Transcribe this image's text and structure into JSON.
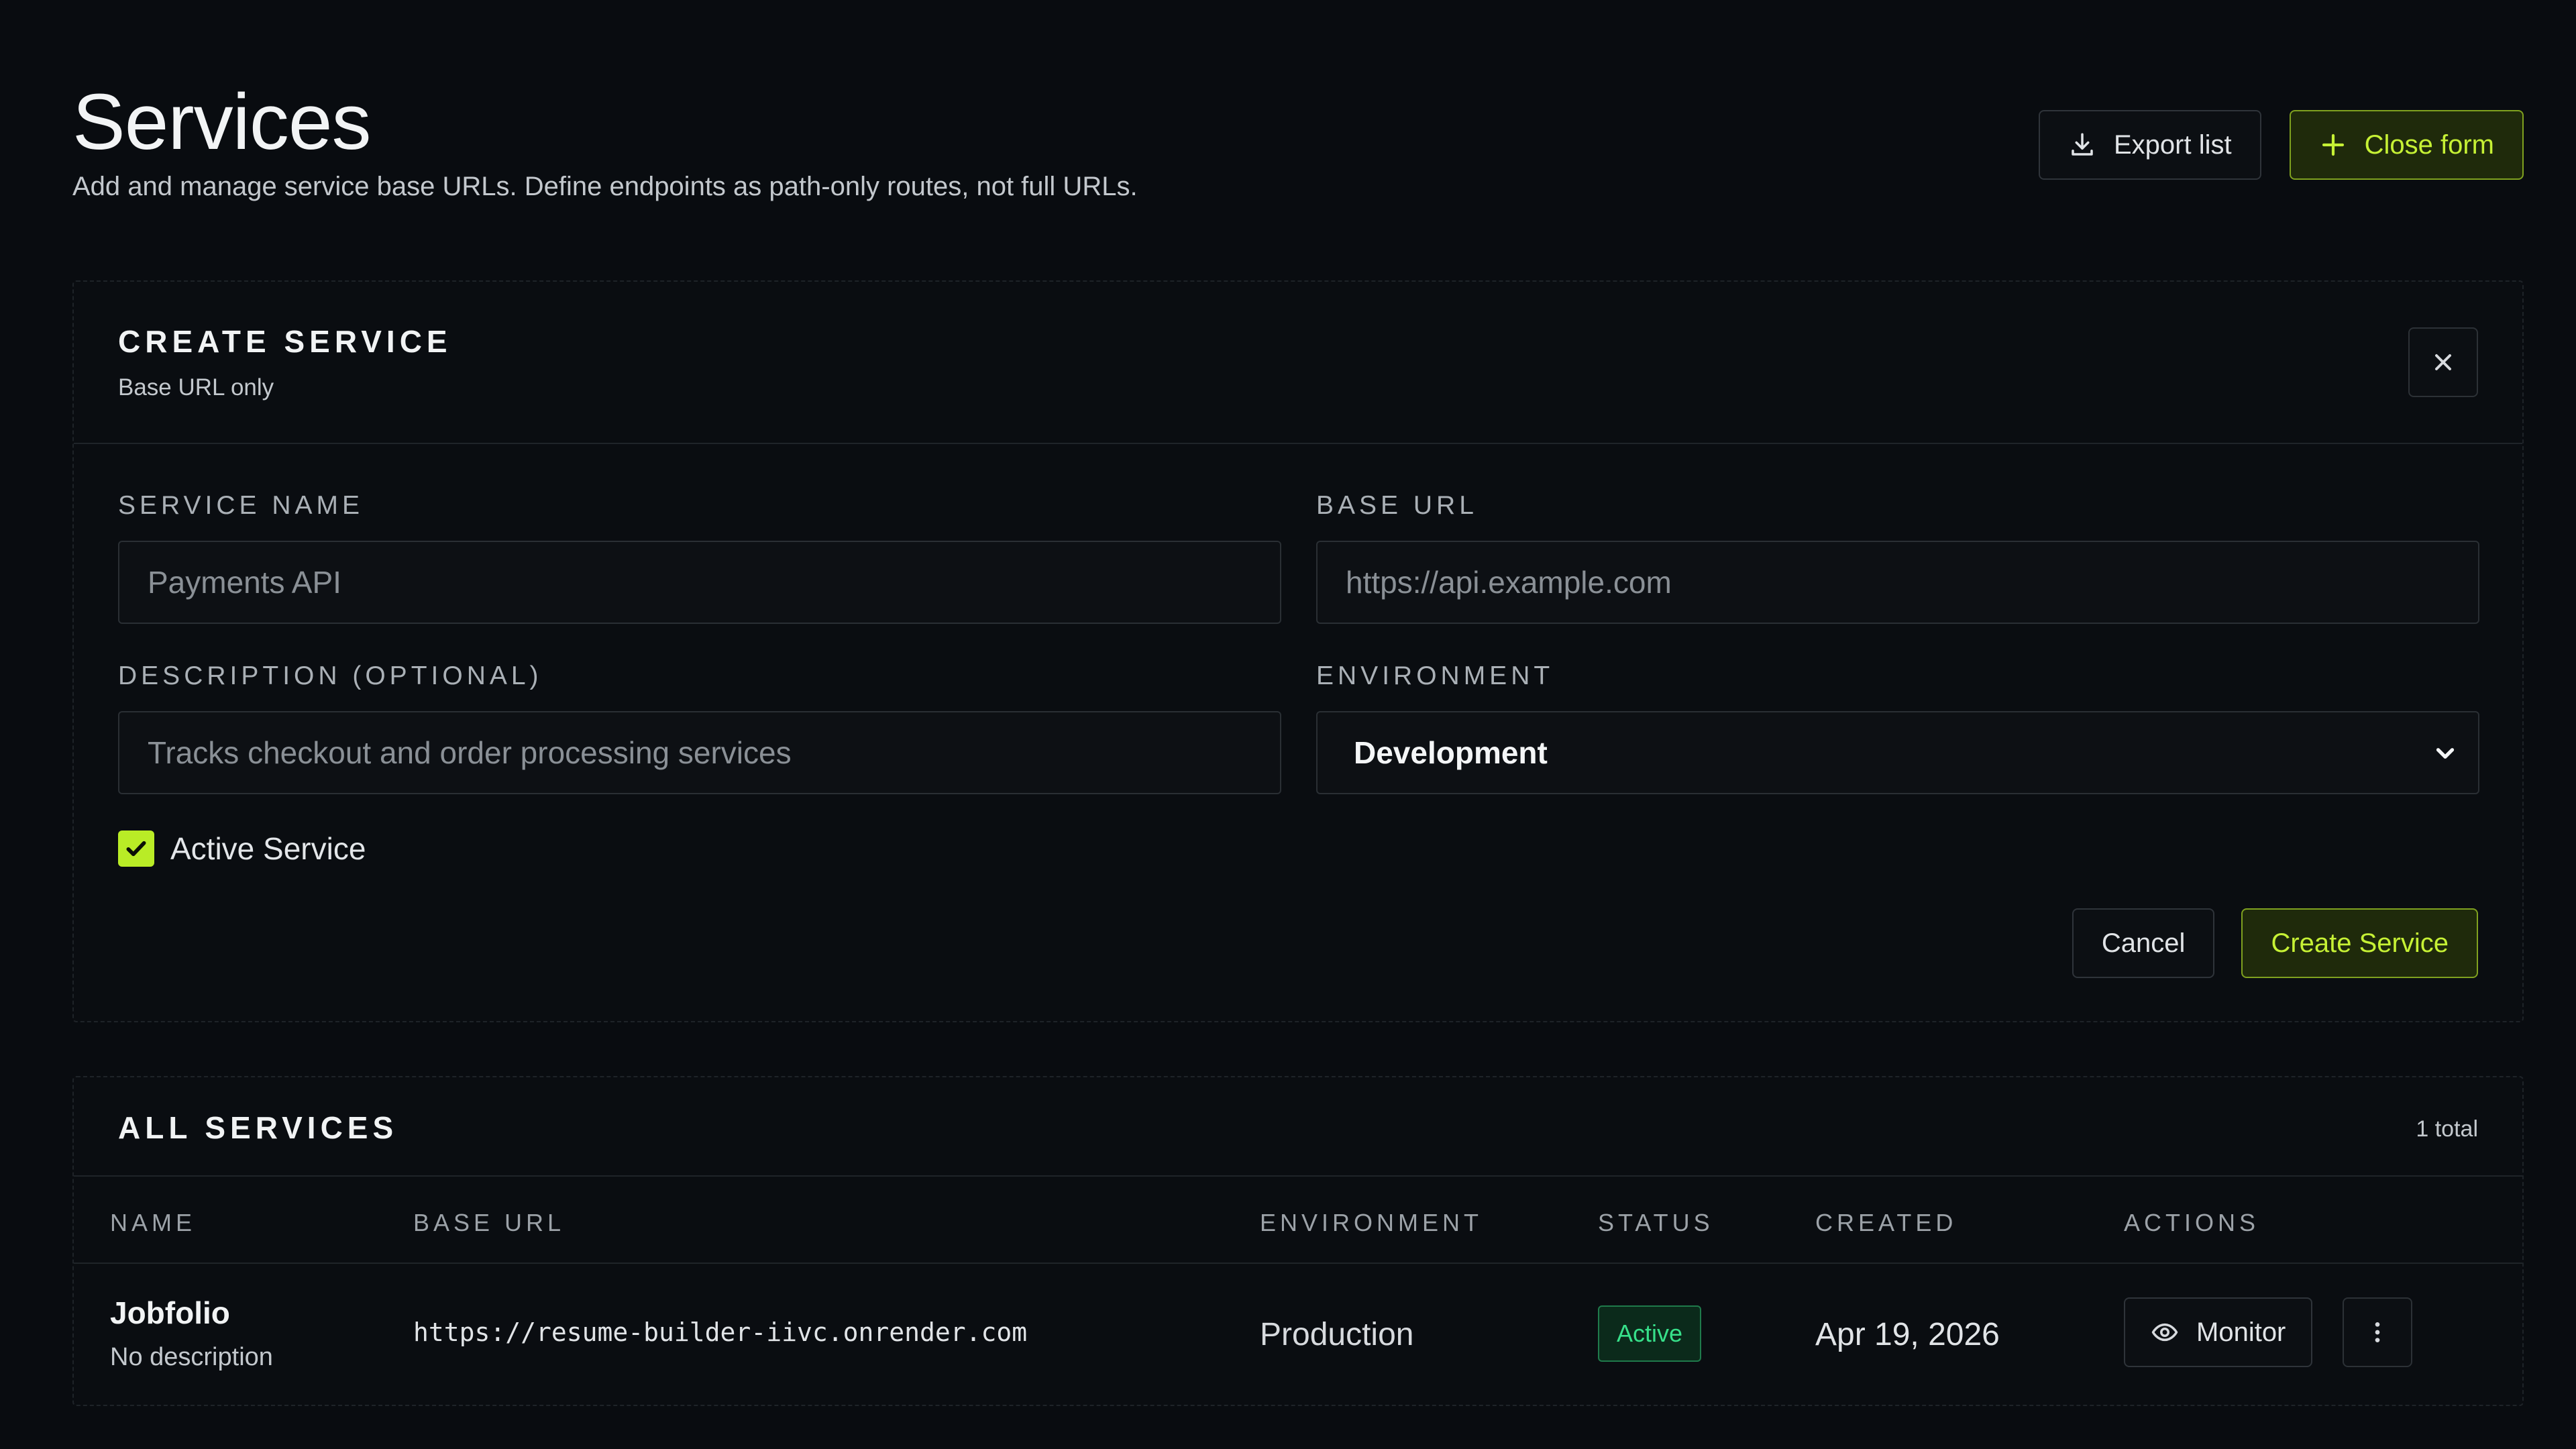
{
  "header": {
    "title": "Services",
    "subtitle": "Add and manage service base URLs. Define endpoints as path-only routes, not full URLs.",
    "export_label": "Export list",
    "close_form_label": "Close form"
  },
  "create_form": {
    "title": "CREATE SERVICE",
    "subtitle": "Base URL only",
    "service_name": {
      "label": "SERVICE NAME",
      "placeholder": "Payments API",
      "value": ""
    },
    "base_url": {
      "label": "BASE URL",
      "placeholder": "https://api.example.com",
      "value": ""
    },
    "description": {
      "label": "DESCRIPTION (OPTIONAL)",
      "placeholder": "Tracks checkout and order processing services",
      "value": ""
    },
    "environment": {
      "label": "ENVIRONMENT",
      "selected": "Development"
    },
    "active": {
      "label": "Active Service",
      "checked": true
    },
    "cancel_label": "Cancel",
    "submit_label": "Create Service"
  },
  "service_list": {
    "title": "ALL SERVICES",
    "count": "1 total",
    "columns": [
      "NAME",
      "BASE URL",
      "ENVIRONMENT",
      "STATUS",
      "CREATED",
      "ACTIONS"
    ],
    "rows": [
      {
        "name": "Jobfolio",
        "description": "No description",
        "base_url": "https://resume-builder-iivc.onrender.com",
        "environment": "Production",
        "status": "Active",
        "created": "Apr 19, 2026",
        "monitor_label": "Monitor"
      }
    ]
  },
  "colors": {
    "background": "#090c10",
    "accent": "#c6f135",
    "accent_bg": "#1f2a0b",
    "status_active": "#37e08a"
  },
  "icons": {
    "export": "download-icon",
    "close_form": "plus-icon",
    "dismiss": "close-icon",
    "select": "chevron-down-icon",
    "checkbox": "check-icon",
    "monitor": "eye-icon",
    "more": "kebab-menu-icon"
  }
}
